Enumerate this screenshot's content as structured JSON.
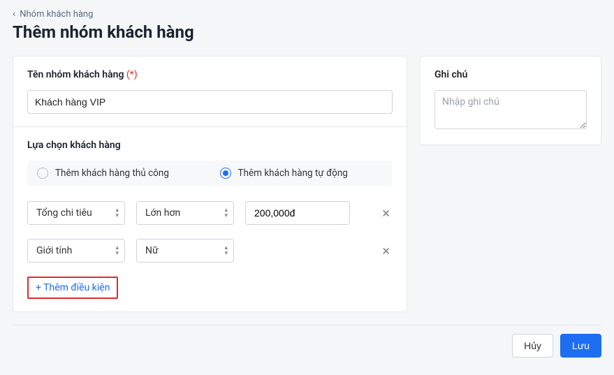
{
  "breadcrumb": {
    "label": "Nhóm khách hàng"
  },
  "page_title": "Thêm nhóm khách hàng",
  "name_section": {
    "label": "Tên nhóm khách hàng",
    "required_marker": "(*)",
    "value": "Khách hàng VIP"
  },
  "selection_section": {
    "label": "Lựa chọn khách hàng",
    "options": {
      "manual": "Thêm khách hàng thủ công",
      "auto": "Thêm khách hàng tự động"
    },
    "selected": "auto",
    "conditions": [
      {
        "field": "Tổng chi tiêu",
        "operator": "Lớn hơn",
        "value": "200,000đ"
      },
      {
        "field": "Giới tính",
        "operator": "Nữ",
        "value": ""
      }
    ],
    "add_condition_label": "+ Thêm điều kiện"
  },
  "notes_section": {
    "label": "Ghi chú",
    "placeholder": "Nhập ghi chú",
    "value": ""
  },
  "footer": {
    "cancel": "Hủy",
    "save": "Lưu"
  }
}
